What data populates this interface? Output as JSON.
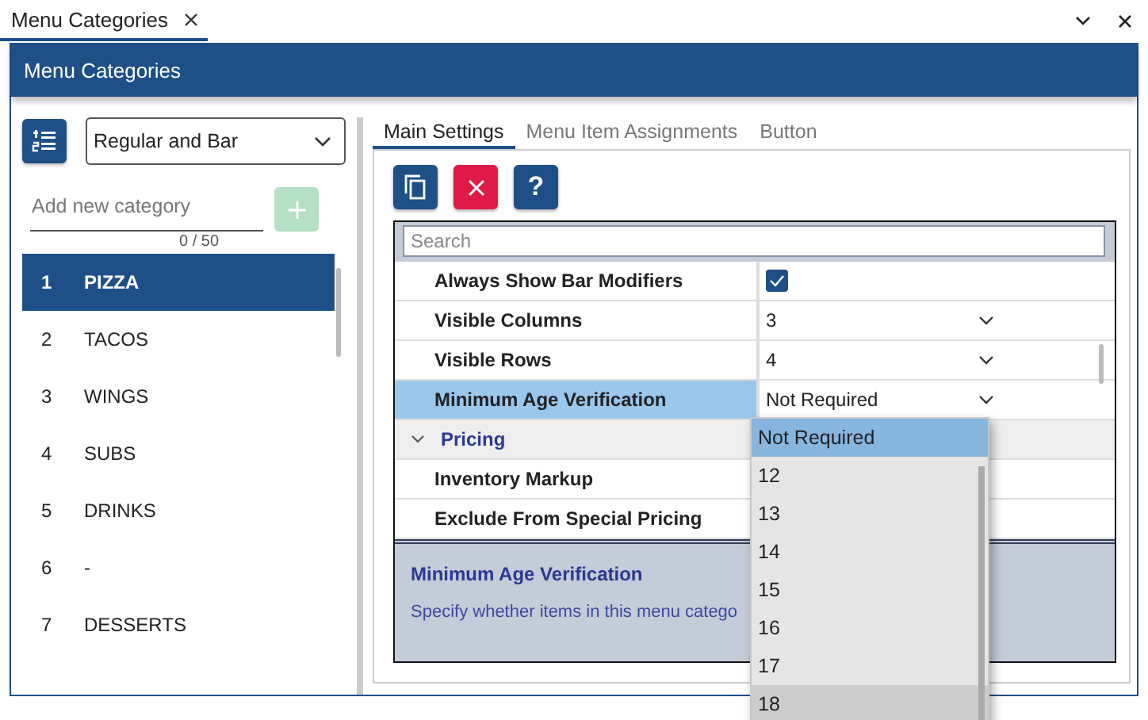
{
  "document_tab": {
    "label": "Menu Categories",
    "selected": true
  },
  "window": {
    "title": "Menu Categories"
  },
  "sidebar": {
    "menu_type": {
      "value": "Regular and Bar"
    },
    "new_category": {
      "placeholder": "Add new category",
      "counter": "0 / 50",
      "add_disabled": true
    },
    "categories": [
      {
        "number": "1",
        "name": "PIZZA",
        "selected": true
      },
      {
        "number": "2",
        "name": "TACOS",
        "selected": false
      },
      {
        "number": "3",
        "name": "WINGS",
        "selected": false
      },
      {
        "number": "4",
        "name": "SUBS",
        "selected": false
      },
      {
        "number": "5",
        "name": "DRINKS",
        "selected": false
      },
      {
        "number": "6",
        "name": "-",
        "selected": false
      },
      {
        "number": "7",
        "name": "DESSERTS",
        "selected": false
      }
    ]
  },
  "tabs": [
    {
      "label": "Main Settings",
      "selected": true
    },
    {
      "label": "Menu Item Assignments",
      "selected": false
    },
    {
      "label": "Button",
      "selected": false
    }
  ],
  "toolbar": [
    {
      "kind": "copy"
    },
    {
      "kind": "delete"
    },
    {
      "kind": "help",
      "label": "?"
    }
  ],
  "properties": {
    "search": {
      "placeholder": "Search"
    },
    "rows": [
      {
        "kind": "checkbox",
        "label": "Always Show Bar Modifiers",
        "checked": true,
        "selected": false
      },
      {
        "kind": "dropdown",
        "label": "Visible Columns",
        "value": "3",
        "selected": false
      },
      {
        "kind": "dropdown",
        "label": "Visible Rows",
        "value": "4",
        "selected": false
      },
      {
        "kind": "dropdown",
        "label": "Minimum Age Verification",
        "value": "Not Required",
        "selected": true
      },
      {
        "kind": "category",
        "label": "Pricing",
        "expanded": true
      },
      {
        "kind": "text",
        "label": "Inventory Markup",
        "selected": false
      },
      {
        "kind": "text",
        "label": "Exclude From Special Pricing",
        "selected": false
      }
    ],
    "description": {
      "title": "Minimum Age Verification",
      "text": "Specify whether items in this menu catego"
    }
  },
  "dropdown_list": {
    "options": [
      {
        "label": "Not Required",
        "selected": true,
        "hovered": false
      },
      {
        "label": "12",
        "selected": false,
        "hovered": false
      },
      {
        "label": "13",
        "selected": false,
        "hovered": false
      },
      {
        "label": "14",
        "selected": false,
        "hovered": false
      },
      {
        "label": "15",
        "selected": false,
        "hovered": false
      },
      {
        "label": "16",
        "selected": false,
        "hovered": false
      },
      {
        "label": "17",
        "selected": false,
        "hovered": false
      },
      {
        "label": "18",
        "selected": false,
        "hovered": true
      }
    ]
  }
}
